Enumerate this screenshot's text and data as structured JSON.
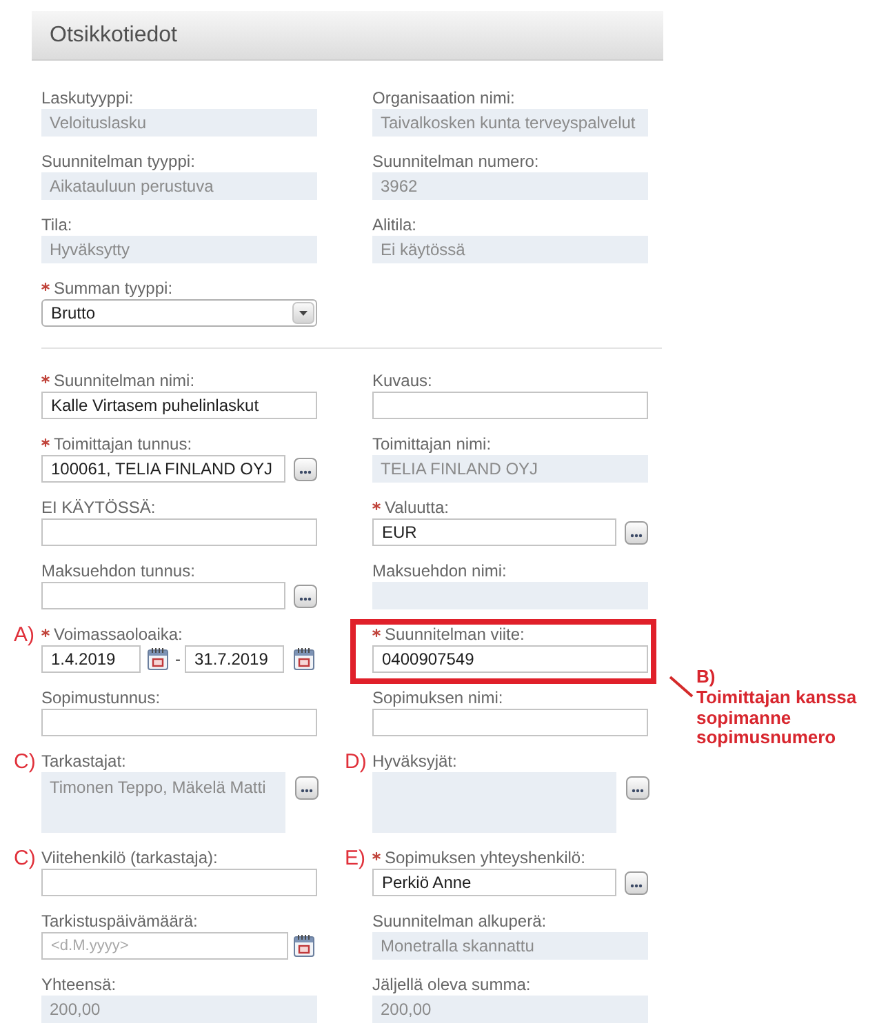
{
  "section": {
    "title": "Otsikkotiedot"
  },
  "groups": [
    {
      "rows": [
        {
          "left": {
            "kind": "readonly",
            "required": false,
            "label": "Laskutyyppi:",
            "value": "Veloituslasku"
          },
          "right": {
            "kind": "readonly",
            "required": false,
            "label": "Organisaation nimi:",
            "value": "Taivalkosken kunta terveyspalvelut"
          }
        },
        {
          "left": {
            "kind": "readonly",
            "required": false,
            "label": "Suunnitelman tyyppi:",
            "value": "Aikatauluun perustuva"
          },
          "right": {
            "kind": "readonly",
            "required": false,
            "label": "Suunnitelman numero:",
            "value": "3962"
          }
        },
        {
          "left": {
            "kind": "readonly",
            "required": false,
            "label": "Tila:",
            "value": "Hyväksytty"
          },
          "right": {
            "kind": "readonly",
            "required": false,
            "label": "Alitila:",
            "value": "Ei käytössä"
          }
        },
        {
          "left": {
            "kind": "select",
            "required": true,
            "label": "Summan tyyppi:",
            "value": "Brutto"
          }
        }
      ]
    },
    {
      "rows": [
        {
          "left": {
            "kind": "input",
            "required": true,
            "label": "Suunnitelman nimi:",
            "value": "Kalle Virtasem puhelinlaskut"
          },
          "right": {
            "kind": "input",
            "required": false,
            "label": "Kuvaus:"
          }
        },
        {
          "left": {
            "kind": "lookup",
            "required": true,
            "label": "Toimittajan tunnus:",
            "value": "100061, TELIA FINLAND OYJ"
          },
          "right": {
            "kind": "readonly",
            "required": false,
            "label": "Toimittajan nimi:",
            "value": "TELIA FINLAND OYJ"
          }
        },
        {
          "left": {
            "kind": "input",
            "required": false,
            "label": "EI KÄYTÖSSÄ:"
          },
          "right": {
            "kind": "lookup",
            "required": true,
            "label": "Valuutta:",
            "value": "EUR"
          }
        },
        {
          "left": {
            "kind": "lookup",
            "required": false,
            "label": "Maksuehdon tunnus:"
          },
          "right": {
            "kind": "readonly",
            "required": false,
            "label": "Maksuehdon nimi:"
          }
        },
        {
          "left": {
            "kind": "date_range",
            "required": true,
            "marker": "A)",
            "label": "Voimassaoloaika:",
            "from": "1.4.2019",
            "separator": "-",
            "to": "31.7.2019"
          },
          "right": {
            "kind": "input",
            "required": true,
            "highlighted": true,
            "label": "Suunnitelman viite:",
            "value": "0400907549",
            "note": {
              "marker": "B)",
              "text": "Toimittajan kanssa sopimanne sopimusnumero"
            }
          }
        },
        {
          "left": {
            "kind": "input",
            "required": false,
            "label": "Sopimustunnus:"
          },
          "right": {
            "kind": "input",
            "required": false,
            "label": "Sopimuksen nimi:"
          }
        },
        {
          "left": {
            "kind": "readonly_lookup",
            "required": false,
            "marker": "C)",
            "label": "Tarkastajat:",
            "value": "Timonen Teppo, Mäkelä Matti"
          },
          "right": {
            "kind": "readonly_lookup",
            "required": false,
            "marker": "D)",
            "label": "Hyväksyjät:"
          }
        },
        {
          "left": {
            "kind": "input",
            "required": false,
            "marker": "C)",
            "label": "Viitehenkilö (tarkastaja):"
          },
          "right": {
            "kind": "lookup",
            "required": true,
            "marker": "E)",
            "label": "Sopimuksen yhteyshenkilö:",
            "value": "Perkiö Anne"
          }
        },
        {
          "left": {
            "kind": "date",
            "required": false,
            "label": "Tarkistuspäivämäärä:",
            "placeholder": "<d.M.yyyy>"
          },
          "right": {
            "kind": "readonly",
            "required": false,
            "label": "Suunnitelman alkuperä:",
            "value": "Monetralla skannattu"
          }
        },
        {
          "left": {
            "kind": "readonly",
            "required": false,
            "label": "Yhteensä:",
            "value": "200,00"
          },
          "right": {
            "kind": "readonly",
            "required": false,
            "label": "Jäljellä oleva summa:",
            "value": "200,00"
          }
        }
      ]
    }
  ]
}
